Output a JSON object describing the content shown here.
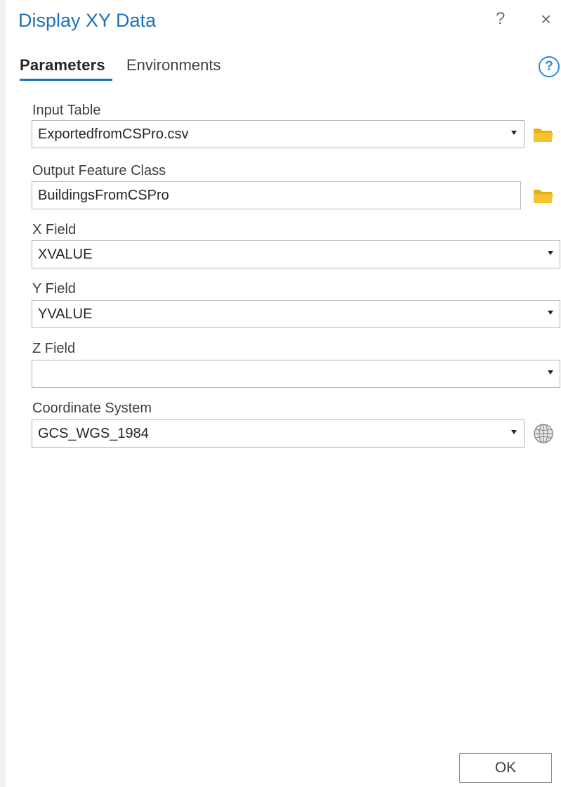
{
  "header": {
    "title": "Display XY Data",
    "help_glyph": "?",
    "close_glyph": "×"
  },
  "tabs": [
    {
      "label": "Parameters",
      "active": true
    },
    {
      "label": "Environments",
      "active": false
    }
  ],
  "help_circle_glyph": "?",
  "params": {
    "input_table": {
      "label": "Input Table",
      "value": "ExportedfromCSPro.csv"
    },
    "output_feature_class": {
      "label": "Output Feature Class",
      "value": "BuildingsFromCSPro"
    },
    "x_field": {
      "label": "X Field",
      "value": "XVALUE"
    },
    "y_field": {
      "label": "Y Field",
      "value": "YVALUE"
    },
    "z_field": {
      "label": "Z Field",
      "value": ""
    },
    "coordinate_system": {
      "label": "Coordinate System",
      "value": "GCS_WGS_1984"
    }
  },
  "footer": {
    "ok_label": "OK"
  },
  "icons": {
    "folder": "folder-icon",
    "globe": "globe-icon",
    "dropdown": "chevron-down-icon"
  },
  "colors": {
    "accent": "#1e72b8",
    "help_blue": "#2c8ae0",
    "folder_yellow": "#f4c430"
  }
}
